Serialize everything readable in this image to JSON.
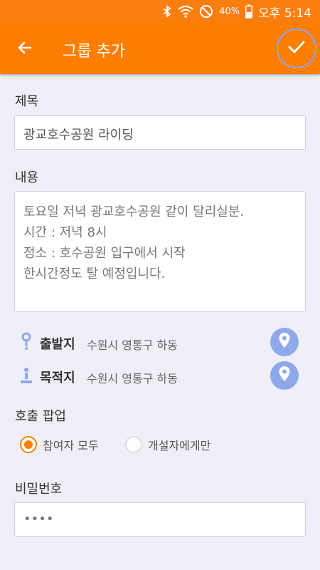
{
  "status_bar": {
    "battery_percent": "40%",
    "time": "오후 5:14"
  },
  "app_bar": {
    "title": "그룹 추가",
    "back_icon": "arrow-left-icon",
    "confirm_icon": "checkmark-icon"
  },
  "form": {
    "title_label": "제목",
    "title_value": "광교호수공원 라이딩",
    "content_label": "내용",
    "content_value": "토요일 저녁 광교호수공원 같이 달리실분.\n시간 : 저녁 8시\n정소 : 호수공원 입구에서 시작\n한시간정도 탈 예정입니다.",
    "departure_label": "출발지",
    "departure_value": "수원시 영통구 하동",
    "destination_label": "목적지",
    "destination_value": "수원시 영통구 하동",
    "popup_label": "호출 팝업",
    "popup_options": [
      "참여자 모두",
      "개설자에게만"
    ],
    "popup_selected": "참여자 모두",
    "password_label": "비밀번호",
    "password_value": "••••"
  },
  "colors": {
    "accent": "#ff7e00",
    "location_button": "#8fa8ea",
    "background": "#efeff8"
  }
}
